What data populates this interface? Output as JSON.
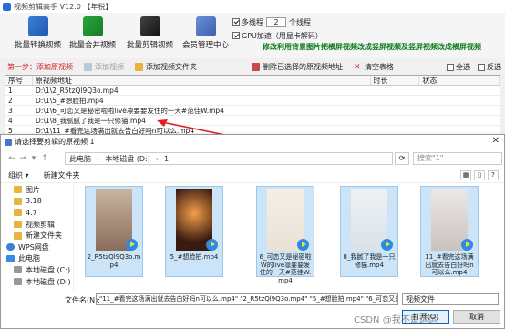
{
  "app": {
    "title": "视频剪辑高手 V12.0 【年税】",
    "toolbar": [
      {
        "label": "批量转换视频"
      },
      {
        "label": "批量合并视频"
      },
      {
        "label": "批量剪辑视频"
      },
      {
        "label": "会员管理中心"
      }
    ],
    "options": {
      "multithread_label": "多线程",
      "thread_count": "2",
      "thread_unit": "个线程",
      "gpu_label": "GPU加速（用显卡解码）",
      "promo": "修改利用背景图片把横屏视频改成竖屏视频及竖屏视频改成横屏视频"
    },
    "stepbar": {
      "step1": "第一步：添加原视频",
      "add_video": "添加视频",
      "add_folder": "添加视频文件夹",
      "delete_selected": "删除已选择的原视频地址",
      "clear": "清空表格",
      "select_all": "全选",
      "invert": "反选"
    },
    "table": {
      "headers": [
        "序号",
        "原视频地址",
        "时长",
        "状态"
      ],
      "rows": [
        {
          "no": "1",
          "path": "D:\\1\\2_R5tzQl9Q3o.mp4"
        },
        {
          "no": "2",
          "path": "D:\\1\\5_#想脸拍.mp4"
        },
        {
          "no": "3",
          "path": "D:\\1\\6_可恋又是秘密啦啦live凛要要发住的一天#范佳W.mp4"
        },
        {
          "no": "4",
          "path": "D:\\1\\8_我腻腻了我是一只修猫.mp4"
        },
        {
          "no": "5",
          "path": "D:\\1\\11_#看完这场满出就去告白好吗n可以么.mp4"
        }
      ]
    }
  },
  "dialog": {
    "title": "请选择要剪辑的原视频 1",
    "close_glyph": "✕",
    "breadcrumbs": [
      "此电脑",
      "本地磁盘 (D:)",
      "1"
    ],
    "search_placeholder": "搜索\"1\"",
    "organize": "组织 ▾",
    "new_folder": "新建文件夹",
    "nav": [
      {
        "label": "图片",
        "type": "folder"
      },
      {
        "label": "3.18",
        "type": "folder"
      },
      {
        "label": "4.7",
        "type": "folder"
      },
      {
        "label": "视频剪辑",
        "type": "folder"
      },
      {
        "label": "新建文件夹",
        "type": "folder"
      },
      {
        "label": "WPS网盘",
        "type": "cloud"
      },
      {
        "label": "此电脑",
        "type": "pc"
      },
      {
        "label": "本地磁盘 (C:)",
        "type": "drive"
      },
      {
        "label": "本地磁盘 (D:)",
        "type": "drive"
      }
    ],
    "files": [
      {
        "name": "2_R5tzQl9Q3o.mp4"
      },
      {
        "name": "5_#想脸拍.mp4"
      },
      {
        "name": "6_可恋又是秘密啦W的live凛要要发住的一天#范佳W.mp4"
      },
      {
        "name": "8_我腻了我是一只修猫.mp4"
      },
      {
        "name": "11_#看完这场满出就去告白好吗n可以么.mp4"
      }
    ],
    "filename_label": "文件名(N):",
    "filename_value": "\"11_#看完这场满出就去告白好吗n可以么.mp4\" \"2_R5tzQl9Q3o.mp4\" \"5_#想脸拍.mp4\" \"6_可恋又是秘密啦",
    "filetype": "视频文件",
    "open": "打开(O)",
    "cancel": "取消"
  },
  "watermark": "CSDN @我不是运运"
}
